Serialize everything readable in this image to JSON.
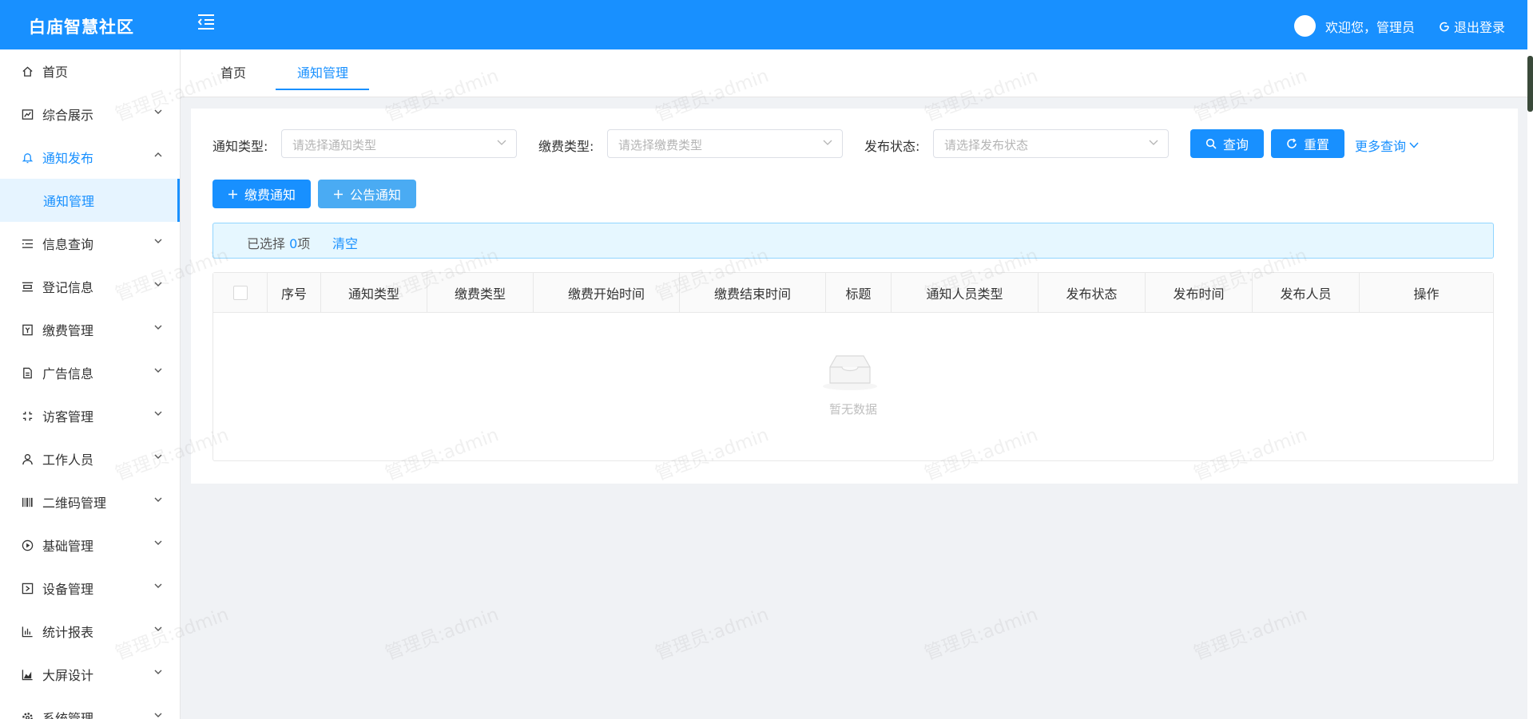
{
  "header": {
    "logo": "白庙智慧社区",
    "greeting": "欢迎您，管理员",
    "logout": "退出登录",
    "bg_color": "#1890ff"
  },
  "sidebar": {
    "items": [
      {
        "label": "首页",
        "icon": "home-icon"
      },
      {
        "label": "综合展示",
        "icon": "chart-icon"
      },
      {
        "label": "通知发布",
        "icon": "bell-icon"
      },
      {
        "label": "通知管理"
      },
      {
        "label": "信息查询",
        "icon": "list-icon"
      },
      {
        "label": "登记信息",
        "icon": "register-icon"
      },
      {
        "label": "缴费管理",
        "icon": "payment-icon"
      },
      {
        "label": "广告信息",
        "icon": "document-icon"
      },
      {
        "label": "访客管理",
        "icon": "visitor-icon"
      },
      {
        "label": "工作人员",
        "icon": "user-icon"
      },
      {
        "label": "二维码管理",
        "icon": "barcode-icon"
      },
      {
        "label": "基础管理",
        "icon": "play-circle-icon"
      },
      {
        "label": "设备管理",
        "icon": "device-icon"
      },
      {
        "label": "统计报表",
        "icon": "bar-chart-icon"
      },
      {
        "label": "大屏设计",
        "icon": "area-chart-icon"
      },
      {
        "label": "系统管理",
        "icon": "gear-icon"
      }
    ]
  },
  "tabs": [
    {
      "label": "首页"
    },
    {
      "label": "通知管理"
    }
  ],
  "filters": {
    "notice_type_label": "通知类型:",
    "notice_type_placeholder": "请选择通知类型",
    "fee_type_label": "缴费类型:",
    "fee_type_placeholder": "请选择缴费类型",
    "status_label": "发布状态:",
    "status_placeholder": "请选择发布状态",
    "query": "查询",
    "reset": "重置",
    "more": "更多查询"
  },
  "actions": {
    "fee_notice": "缴费通知",
    "announcement": "公告通知"
  },
  "selection": {
    "prefix": "已选择",
    "count": "0",
    "suffix": "项",
    "clear": "清空"
  },
  "table": {
    "columns": [
      "序号",
      "通知类型",
      "缴费类型",
      "缴费开始时间",
      "缴费结束时间",
      "标题",
      "通知人员类型",
      "发布状态",
      "发布时间",
      "发布人员",
      "操作"
    ],
    "empty_text": "暂无数据"
  },
  "watermark": "管理员:admin"
}
